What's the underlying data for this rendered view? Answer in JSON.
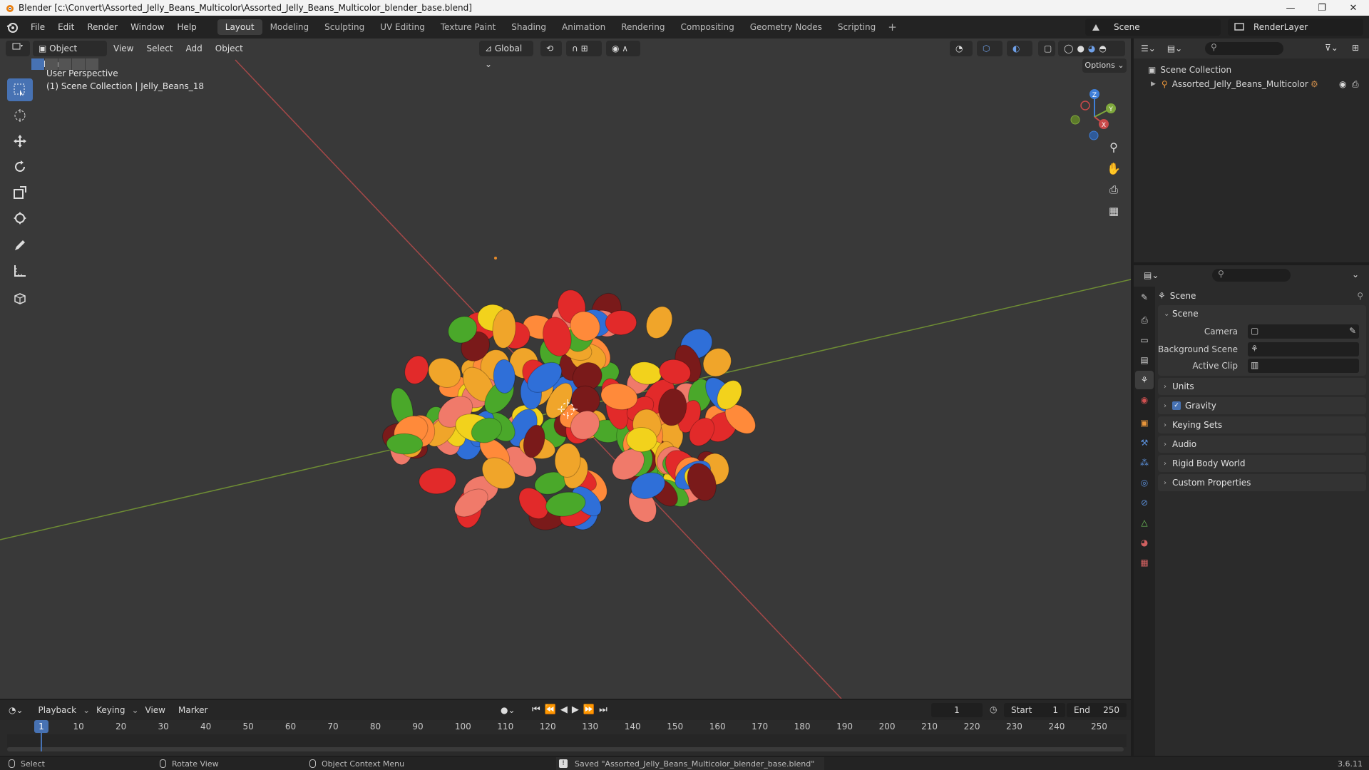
{
  "window": {
    "title": "Blender [c:\\Convert\\Assorted_Jelly_Beans_Multicolor\\Assorted_Jelly_Beans_Multicolor_blender_base.blend]",
    "minimize": "—",
    "maximize": "❐",
    "close": "✕"
  },
  "menu": {
    "items": [
      "File",
      "Edit",
      "Render",
      "Window",
      "Help"
    ]
  },
  "workspaces": {
    "tabs": [
      "Layout",
      "Modeling",
      "Sculpting",
      "UV Editing",
      "Texture Paint",
      "Shading",
      "Animation",
      "Rendering",
      "Compositing",
      "Geometry Nodes",
      "Scripting"
    ],
    "active": "Layout",
    "add": "+"
  },
  "scene_selector": {
    "label": "Scene"
  },
  "view_layer": {
    "label": "RenderLayer"
  },
  "viewport": {
    "mode": "Object Mode",
    "menus": [
      "View",
      "Select",
      "Add",
      "Object"
    ],
    "orientation": "Global",
    "options": "Options",
    "overlay_line1": "User Perspective",
    "overlay_line2": "(1) Scene Collection | Jelly_Beans_18",
    "gizmo": {
      "x": "X",
      "y": "Y",
      "z": "Z"
    }
  },
  "outliner": {
    "root": "Scene Collection",
    "child": "Assorted_Jelly_Beans_Multicolor"
  },
  "properties": {
    "context": "Scene",
    "panel_scene": "Scene",
    "camera_label": "Camera",
    "background_label": "Background Scene",
    "clip_label": "Active Clip",
    "collapsed": [
      "Units",
      "Gravity",
      "Keying Sets",
      "Audio",
      "Rigid Body World",
      "Custom Properties"
    ],
    "gravity_enabled": true
  },
  "timeline": {
    "menus": [
      "Playback",
      "Keying",
      "View",
      "Marker"
    ],
    "current_frame": "1",
    "start_label": "Start",
    "start": "1",
    "end_label": "End",
    "end": "250",
    "ticks": [
      "1",
      "10",
      "20",
      "30",
      "40",
      "50",
      "60",
      "70",
      "80",
      "90",
      "100",
      "110",
      "120",
      "130",
      "140",
      "150",
      "160",
      "170",
      "180",
      "190",
      "200",
      "210",
      "220",
      "230",
      "240",
      "250"
    ]
  },
  "status": {
    "select": "Select",
    "rotate": "Rotate View",
    "context_menu": "Object Context Menu",
    "message": "Saved \"Assorted_Jelly_Beans_Multicolor_blender_base.blend\"",
    "version": "3.6.11"
  },
  "colors": {
    "accent": "#4772b3",
    "x_axis": "#c94a4a",
    "y_axis": "#7fa83c",
    "z_axis": "#3f7fd8"
  }
}
